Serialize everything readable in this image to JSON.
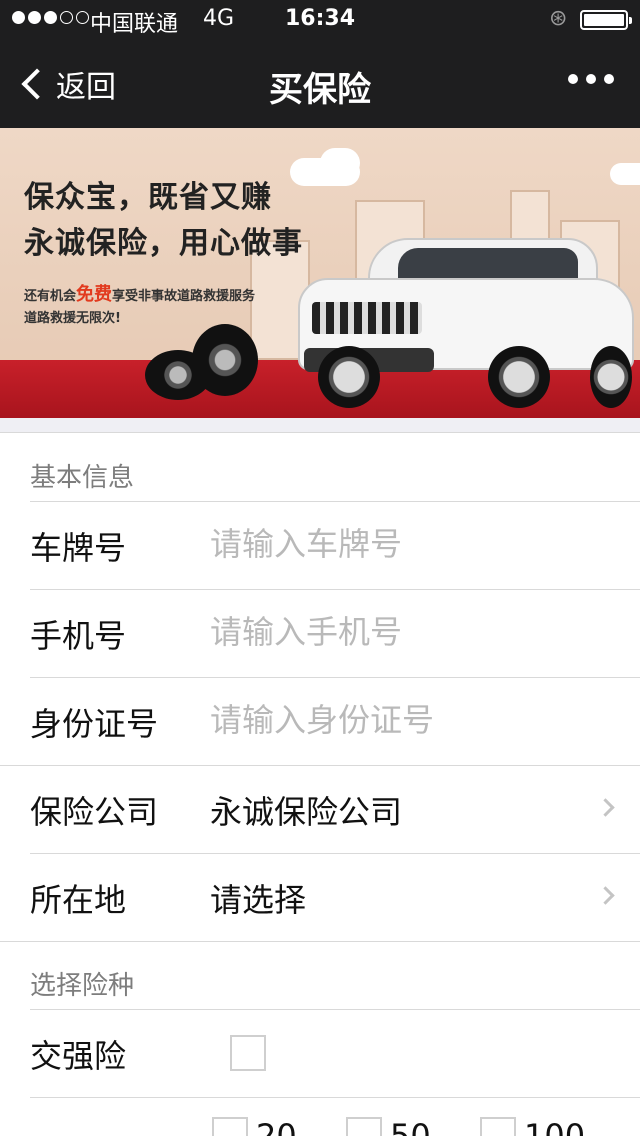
{
  "status_bar": {
    "carrier": "中国联通",
    "network": "4G",
    "time": "16:34"
  },
  "nav": {
    "back_label": "返回",
    "title": "买保险"
  },
  "banner": {
    "headline_1": "保众宝，既省又赚",
    "headline_2": "永诚保险，用心做事",
    "promo_prefix": "还有机会",
    "promo_highlight": "免费",
    "promo_suffix": "享受非事故道路救援服务",
    "promo_line2": "道路救援无限次!"
  },
  "form": {
    "section_basic": "基本信息",
    "plate_label": "车牌号",
    "plate_placeholder": "请输入车牌号",
    "phone_label": "手机号",
    "phone_placeholder": "请输入手机号",
    "id_label": "身份证号",
    "id_placeholder": "请输入身份证号",
    "insurer_label": "保险公司",
    "insurer_value": "永诚保险公司",
    "location_label": "所在地",
    "location_value": "请选择",
    "section_types": "选择险种",
    "compulsory_label": "交强险",
    "amount_options": [
      "20",
      "50",
      "100"
    ]
  },
  "colors": {
    "bar_bg": "#1e1e1f",
    "banner_red": "#c8202a",
    "highlight": "#e23a1e"
  }
}
